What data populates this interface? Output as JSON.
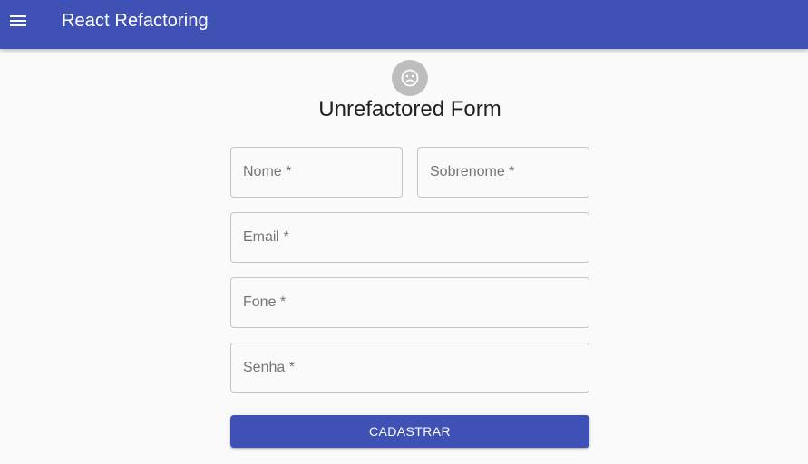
{
  "appbar": {
    "title": "React Refactoring",
    "menu_icon": "menu-icon",
    "color": "#3f51b5"
  },
  "form": {
    "avatar_icon": "sad-face-icon",
    "title": "Unrefactored Form",
    "fields": {
      "nome": {
        "placeholder": "Nome *",
        "value": ""
      },
      "sobrenome": {
        "placeholder": "Sobrenome *",
        "value": ""
      },
      "email": {
        "placeholder": "Email *",
        "value": ""
      },
      "fone": {
        "placeholder": "Fone *",
        "value": ""
      },
      "senha": {
        "placeholder": "Senha *",
        "value": ""
      }
    },
    "submit_label": "CADASTRAR"
  }
}
